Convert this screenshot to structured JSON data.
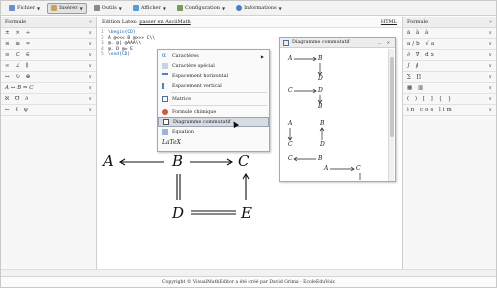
{
  "menubar": {
    "items": [
      {
        "label": "Fichier",
        "icon": "file-icon",
        "color": "#6b8fc9"
      },
      {
        "label": "Insérer",
        "icon": "insert-icon",
        "color": "#c9a35b",
        "active": true
      },
      {
        "label": "Outils",
        "icon": "tools-icon",
        "color": "#8a8a8a"
      },
      {
        "label": "Afficher",
        "icon": "view-icon",
        "color": "#5b9bd5"
      },
      {
        "label": "Configuration",
        "icon": "settings-icon",
        "color": "#7a9a5a"
      },
      {
        "label": "Informations",
        "icon": "info-icon",
        "color": "#4a7fc1"
      }
    ]
  },
  "left_panel": {
    "title": "Formule",
    "rows": [
      "±  ×  ÷",
      "≤  ≅  ≈",
      "≡  ⊂  ∈",
      "∞  ∠  ∥",
      "↔  ↻  ⊕",
      "A ↔ B ⇒ C",
      "ℵ  ℧  ∂",
      "←  ℓ  ψ"
    ]
  },
  "right_panel": {
    "title": "Formule",
    "rows": [
      "ā  ȁ  â",
      "a/b  √a",
      "∂  ∇  dx",
      "∫  ∮",
      "∑  ∏",
      "▦  ▥",
      "( )  [ ]  { }",
      "in  cos  lim"
    ]
  },
  "editor": {
    "title_prefix": "Edition Latex:",
    "title_link": "passer en AsciiMath",
    "right_label": "HTML",
    "code": [
      {
        "n": "1",
        "cmd": "\\begin{CD}",
        "text": ""
      },
      {
        "n": "2",
        "cmd": "",
        "text": "A @<<< B @>>> C\\\\"
      },
      {
        "n": "3",
        "cmd": "",
        "text": "@. @| @AAA\\\\"
      },
      {
        "n": "4",
        "cmd": "",
        "text": "@. D @= E"
      },
      {
        "n": "5",
        "cmd": "\\end{CD}",
        "text": ""
      }
    ]
  },
  "rendered": {
    "A": "A",
    "B": "B",
    "C": "C",
    "D": "D",
    "E": "E"
  },
  "context_menu": {
    "items": [
      {
        "label": "Caractères",
        "icon": "alpha-icon",
        "submenu": true
      },
      {
        "label": "Caractère spécial",
        "icon": "special-char-icon"
      },
      {
        "label": "Espacement horizontal",
        "icon": "hspace-icon"
      },
      {
        "label": "Espacement vertical",
        "icon": "vspace-icon"
      },
      {
        "label": "Matrice",
        "icon": "matrix-icon"
      },
      {
        "label": "Formule chimique",
        "icon": "chemistry-icon"
      },
      {
        "label": "Diagramme commutatif",
        "icon": "diagram-icon",
        "selected": true
      },
      {
        "label": "Equation",
        "icon": "equation-icon"
      },
      {
        "label": "LaTeX",
        "icon": "latex-icon"
      }
    ]
  },
  "palette": {
    "title": "Diagramme commutatif"
  },
  "footer": {
    "text": "Copyright © VisualMathEditor a été créé par David Grima - EcoleEduVoiz"
  }
}
